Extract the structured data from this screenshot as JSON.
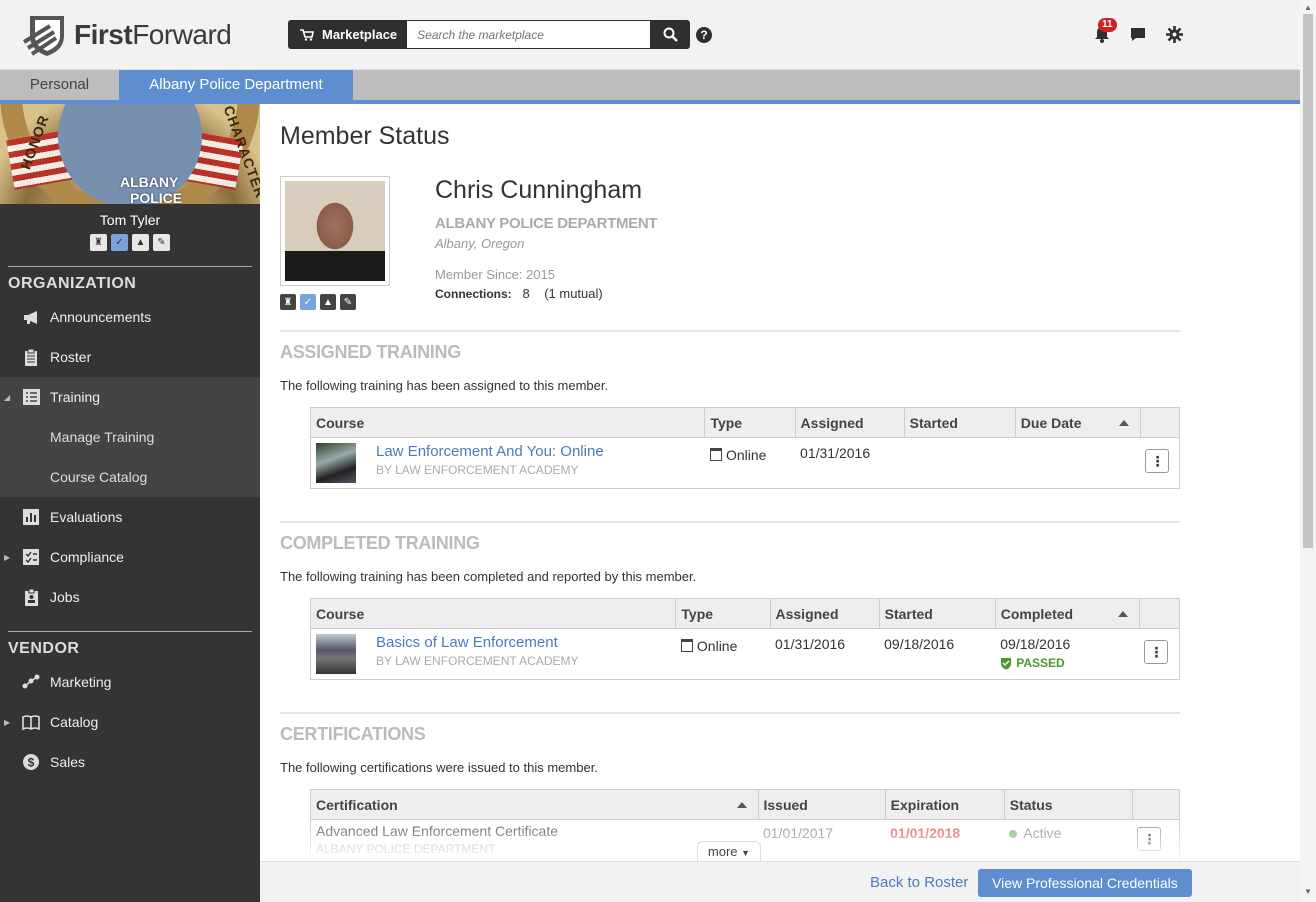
{
  "brand": {
    "name_bold": "First",
    "name_rest": "Forward"
  },
  "header": {
    "marketplace_label": "Marketplace",
    "search_placeholder": "Search the marketplace",
    "help_glyph": "?",
    "notification_count": "11",
    "icons": [
      "cart-icon",
      "search-icon",
      "help-icon",
      "bell-icon",
      "chat-icon",
      "gear-icon"
    ]
  },
  "tabs": [
    {
      "label": "Personal",
      "active": false
    },
    {
      "label": "Albany Police Department",
      "active": true
    }
  ],
  "sidebar": {
    "banner_text": "ALBANY",
    "banner_text2": "POLICE",
    "banner_words": [
      "HONOR",
      "CHARACTER"
    ],
    "user_name": "Tom Tyler",
    "org_title": "ORGANIZATION",
    "org_items": [
      {
        "label": "Announcements",
        "icon": "megaphone-icon"
      },
      {
        "label": "Roster",
        "icon": "clipboard-icon"
      },
      {
        "label": "Training",
        "icon": "list-icon",
        "expanded": true
      },
      {
        "label": "Manage Training",
        "sub": true
      },
      {
        "label": "Course Catalog",
        "sub": true
      },
      {
        "label": "Evaluations",
        "icon": "bar-chart-icon"
      },
      {
        "label": "Compliance",
        "icon": "checklist-icon"
      },
      {
        "label": "Jobs",
        "icon": "id-badge-icon"
      }
    ],
    "vendor_title": "VENDOR",
    "vendor_items": [
      {
        "label": "Marketing",
        "icon": "network-icon"
      },
      {
        "label": "Catalog",
        "icon": "book-icon"
      },
      {
        "label": "Sales",
        "icon": "dollar-icon"
      }
    ]
  },
  "main": {
    "title": "Member Status",
    "member": {
      "name": "Chris Cunningham",
      "department": "ALBANY POLICE DEPARTMENT",
      "location": "Albany, Oregon",
      "since": "Member Since: 2015",
      "connections_label": "Connections:",
      "connections_count": "8",
      "connections_mutual": "(1 mutual)"
    },
    "assigned": {
      "title": "ASSIGNED TRAINING",
      "desc": "The following training has been assigned to this member.",
      "columns": [
        "Course",
        "Type",
        "Assigned",
        "Started",
        "Due Date"
      ],
      "rows": [
        {
          "course": "Law Enforcement And You: Online",
          "by": "BY LAW ENFORCEMENT ACADEMY",
          "type": "Online",
          "assigned": "01/31/2016",
          "started": "",
          "due": ""
        }
      ]
    },
    "completed": {
      "title": "COMPLETED TRAINING",
      "desc": "The following training has been completed and reported by this member.",
      "columns": [
        "Course",
        "Type",
        "Assigned",
        "Started",
        "Completed"
      ],
      "rows": [
        {
          "course": "Basics of Law Enforcement",
          "by": "BY LAW ENFORCEMENT ACADEMY",
          "type": "Online",
          "assigned": "01/31/2016",
          "started": "09/18/2016",
          "completed": "09/18/2016",
          "status": "PASSED"
        }
      ]
    },
    "certs": {
      "title": "CERTIFICATIONS",
      "desc": "The following certifications were issued to this member.",
      "columns": [
        "Certification",
        "Issued",
        "Expiration",
        "Status"
      ],
      "rows": [
        {
          "name": "Advanced Law Enforcement Certificate",
          "org": "ALBANY POLICE DEPARTMENT",
          "issued": "01/01/2017",
          "expiration": "01/01/2018",
          "status": "Active"
        }
      ]
    }
  },
  "footer": {
    "more_label": "more",
    "back_label": "Back to Roster",
    "credentials_label": "View Professional Credentials"
  },
  "colors": {
    "accent": "#5f8ed0",
    "link": "#4a7bc0",
    "sidebar": "#343434",
    "passed": "#4a9a2a",
    "expired": "#e06060"
  }
}
